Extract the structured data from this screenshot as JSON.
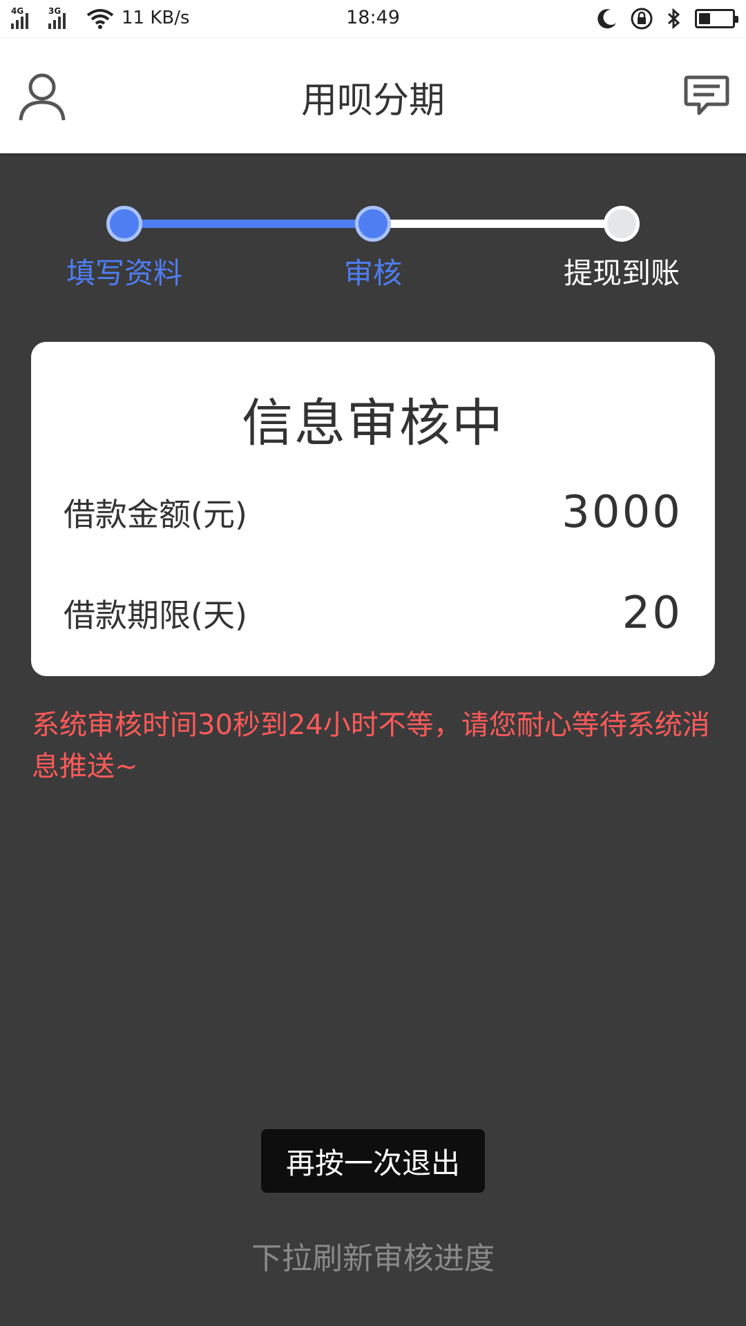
{
  "status_bar": {
    "network1": "4G",
    "network2": "3G",
    "speed": "11 KB/s",
    "time": "18:49",
    "icons": [
      "wifi-icon",
      "moon-icon",
      "rotation-lock-icon",
      "bluetooth-icon",
      "battery-icon"
    ],
    "battery_level": 0.35
  },
  "header": {
    "title": "用呗分期",
    "left_icon": "user-icon",
    "right_icon": "message-icon"
  },
  "stepper": {
    "steps": [
      {
        "label": "填写资料",
        "state": "done"
      },
      {
        "label": "审核",
        "state": "current"
      },
      {
        "label": "提现到账",
        "state": "pending"
      }
    ],
    "active_color": "#4e7ef2"
  },
  "card": {
    "title": "信息审核中",
    "rows": [
      {
        "label": "借款金额(元)",
        "value": "3000"
      },
      {
        "label": "借款期限(天)",
        "value": "20"
      }
    ]
  },
  "notice": {
    "text": "系统审核时间30秒到24小时不等，请您耐心等待系统消息推送~",
    "color": "#ff5a5a"
  },
  "toast": {
    "text": "再按一次退出"
  },
  "pull_hint": {
    "text": "下拉刷新审核进度"
  }
}
